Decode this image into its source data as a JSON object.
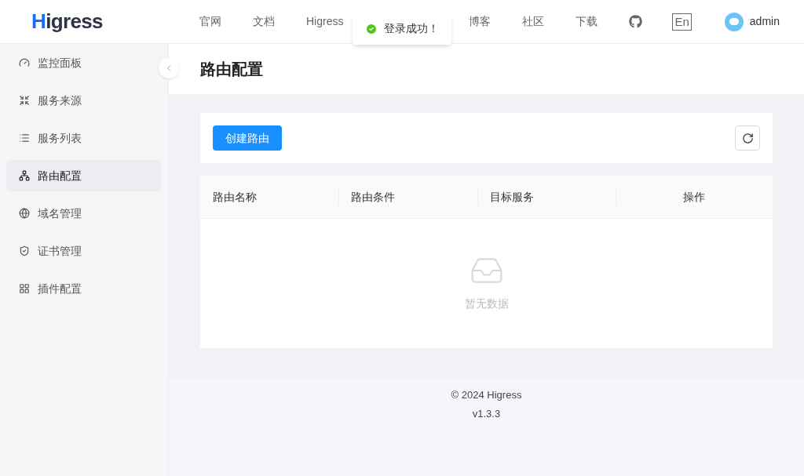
{
  "header": {
    "logo": "Higress",
    "nav": [
      {
        "label": "官网",
        "kind": "text"
      },
      {
        "label": "文档",
        "kind": "text"
      },
      {
        "label": "Higress",
        "kind": "text"
      },
      {
        "label": "博客",
        "kind": "text"
      },
      {
        "label": "社区",
        "kind": "text"
      },
      {
        "label": "下载",
        "kind": "text"
      },
      {
        "kind": "github"
      },
      {
        "label": "En",
        "kind": "lang"
      }
    ],
    "user": "admin"
  },
  "toast": {
    "message": "登录成功！"
  },
  "sidebar": {
    "items": [
      {
        "label": "监控面板",
        "selected": false
      },
      {
        "label": "服务来源",
        "selected": false
      },
      {
        "label": "服务列表",
        "selected": false
      },
      {
        "label": "路由配置",
        "selected": true
      },
      {
        "label": "域名管理",
        "selected": false
      },
      {
        "label": "证书管理",
        "selected": false
      },
      {
        "label": "插件配置",
        "selected": false
      }
    ]
  },
  "page": {
    "title": "路由配置",
    "create_button": "创建路由"
  },
  "table": {
    "columns": [
      "路由名称",
      "路由条件",
      "目标服务",
      "操作"
    ],
    "empty_text": "暂无数据"
  },
  "footer": {
    "copyright": "© 2024 Higress",
    "version": "v1.3.3"
  }
}
